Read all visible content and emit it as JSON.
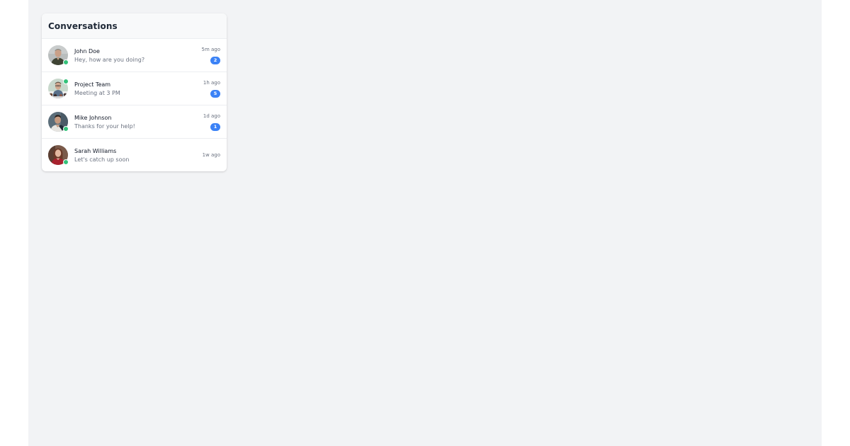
{
  "panel": {
    "title": "Conversations"
  },
  "colors": {
    "background": "#f2f3f5",
    "online": "#34c27a",
    "badge": "#3b82f6"
  },
  "conversations": [
    {
      "name": "John Doe",
      "preview": "Hey, how are you doing?",
      "time": "5m ago",
      "unread": "2",
      "online": true,
      "avatar": "person-avatar"
    },
    {
      "name": "Project Team",
      "preview": "Meeting at 3 PM",
      "time": "1h ago",
      "unread": "5",
      "online": true,
      "avatar": "group-avatar"
    },
    {
      "name": "Mike Johnson",
      "preview": "Thanks for your help!",
      "time": "1d ago",
      "unread": "1",
      "online": true,
      "avatar": "person-avatar"
    },
    {
      "name": "Sarah Williams",
      "preview": "Let's catch up soon",
      "time": "1w ago",
      "unread": "",
      "online": true,
      "avatar": "person-avatar"
    }
  ]
}
